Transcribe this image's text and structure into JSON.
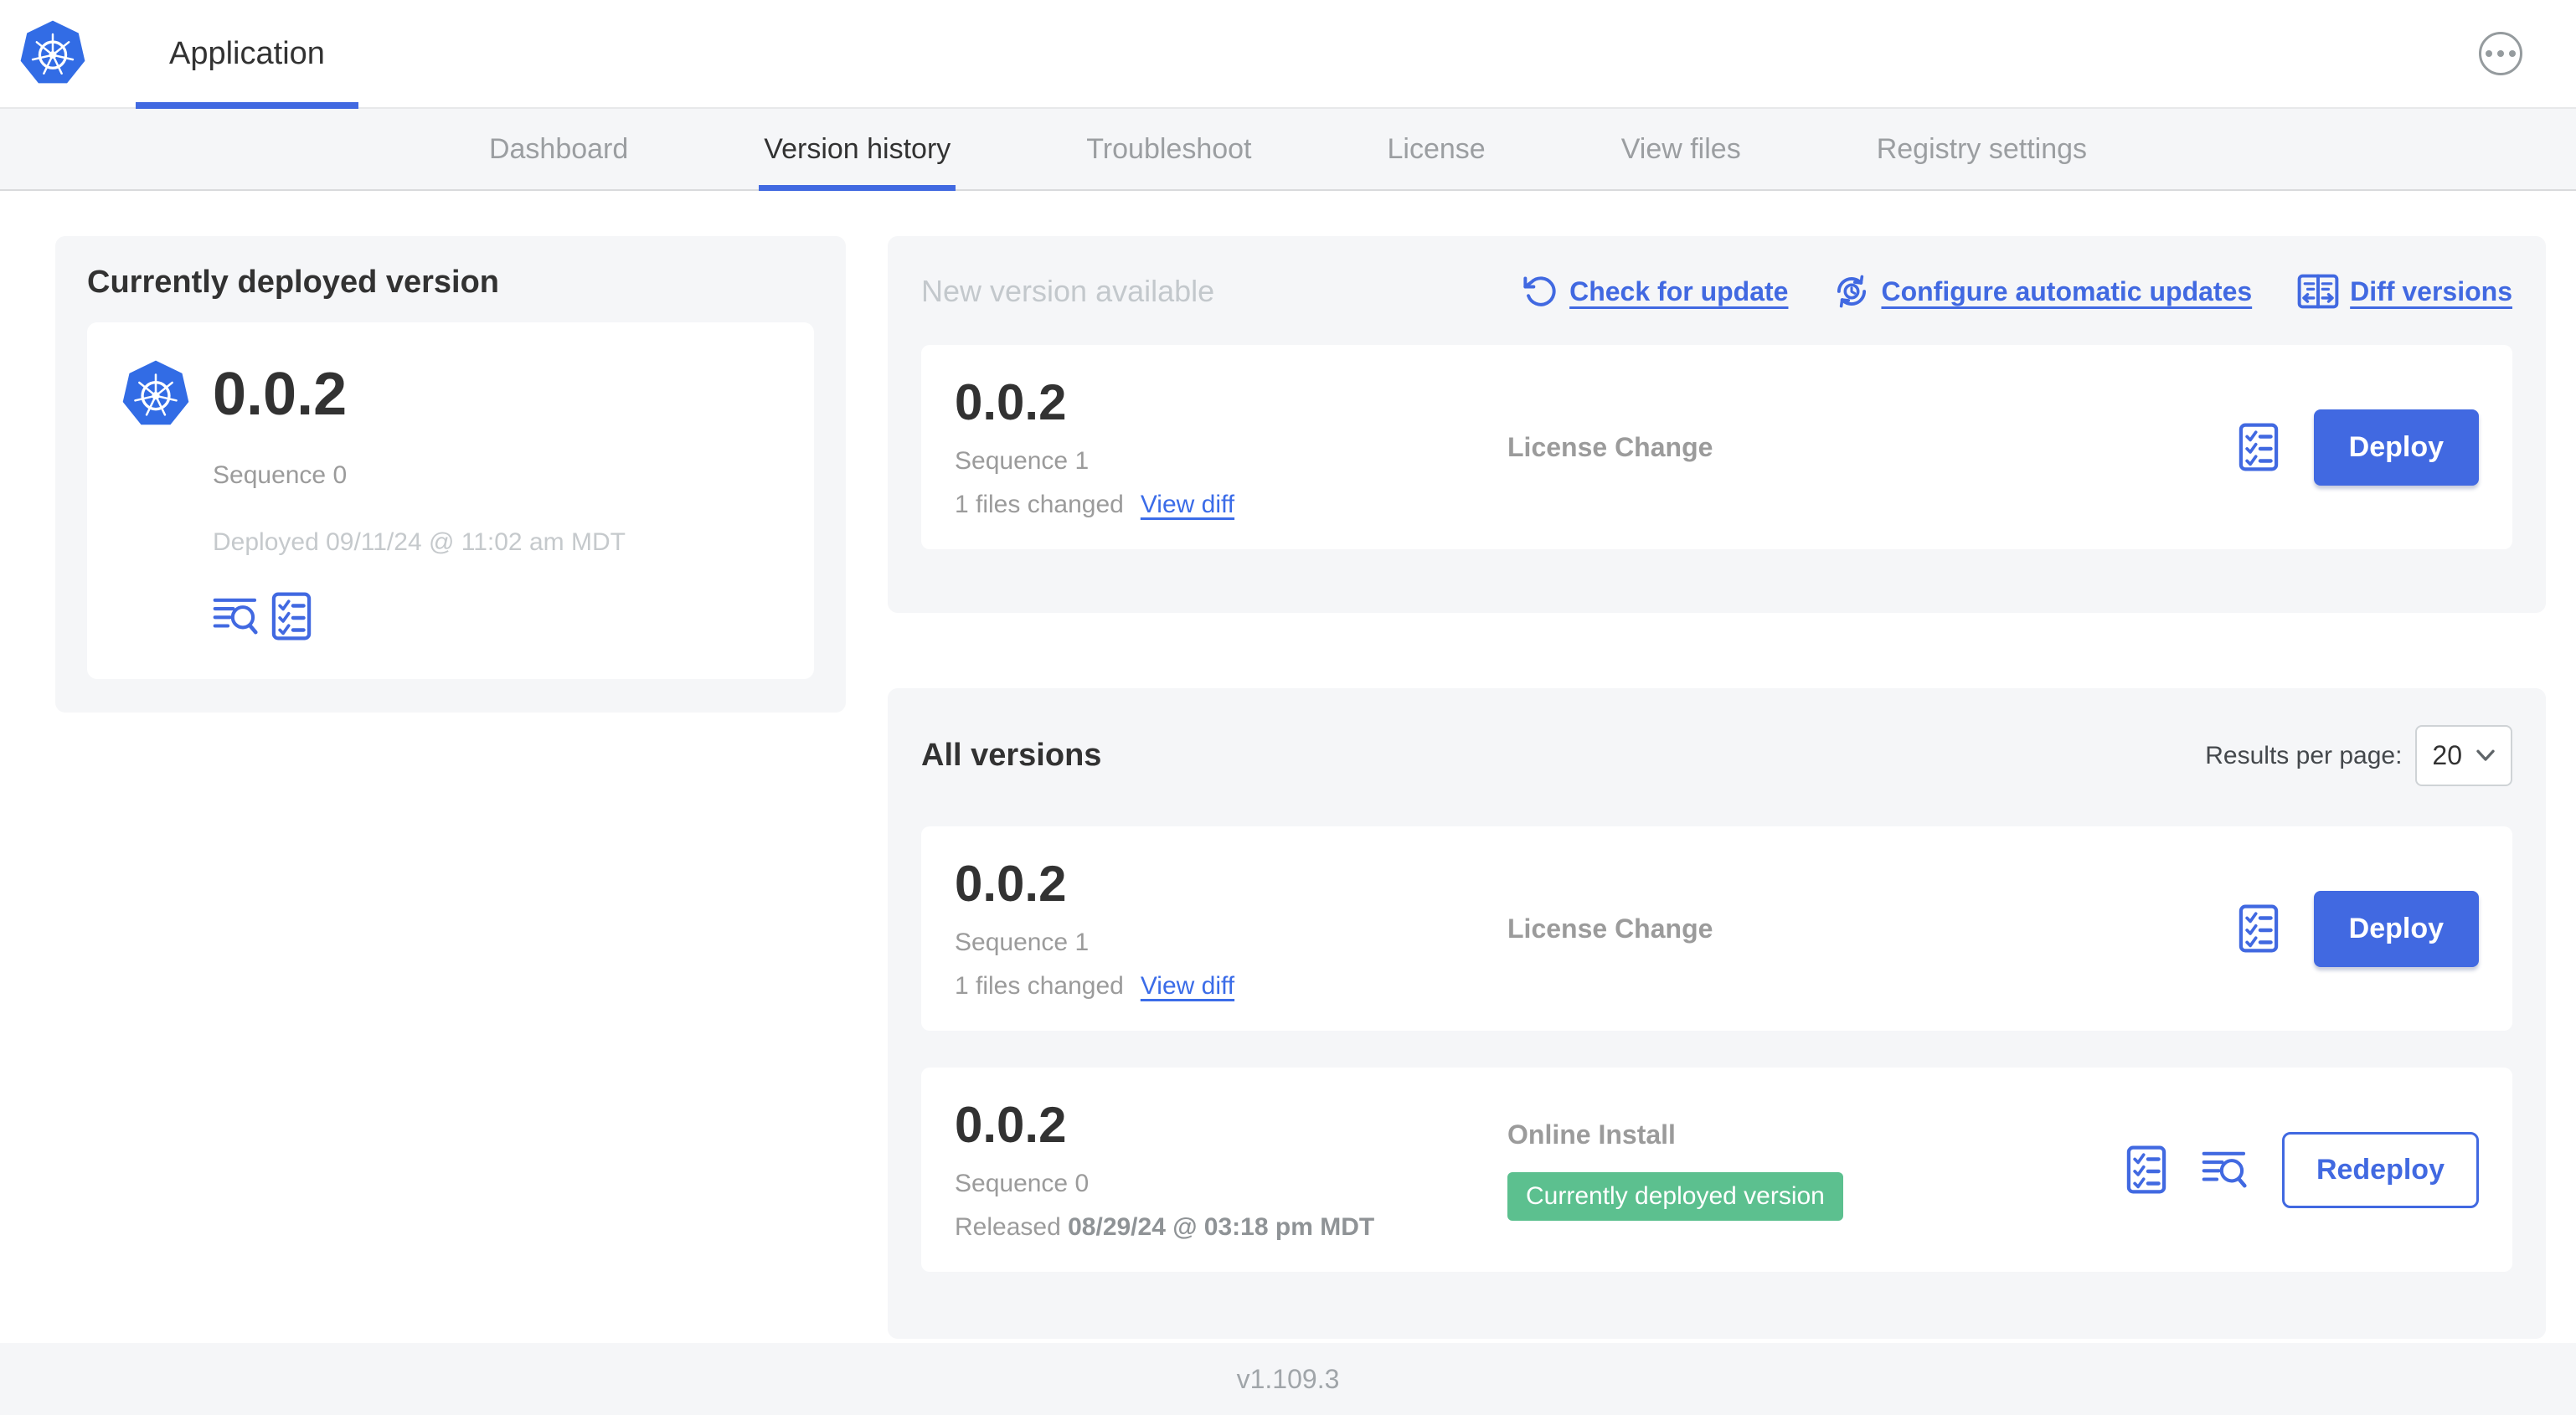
{
  "colors": {
    "accent_blue": "#4169e1",
    "kubernetes_blue": "#326ce5",
    "badge_green": "#5cc08f",
    "text_dark": "#323232",
    "text_gray": "#9b9b9b",
    "text_faint_gray": "#c3c8cc",
    "section_background": "#f5f6f8"
  },
  "header": {
    "app_tab_label": "Application",
    "logo_icon": "kubernetes-logo-icon",
    "more_icon": "ellipsis-icon"
  },
  "subnav": {
    "tabs": [
      {
        "label": "Dashboard",
        "active": false
      },
      {
        "label": "Version history",
        "active": true
      },
      {
        "label": "Troubleshoot",
        "active": false
      },
      {
        "label": "License",
        "active": false
      },
      {
        "label": "View files",
        "active": false
      },
      {
        "label": "Registry settings",
        "active": false
      }
    ]
  },
  "deployed": {
    "title": "Currently deployed version",
    "version": "0.0.2",
    "sequence": "Sequence 0",
    "deployed_at": "Deployed 09/11/24 @ 11:02 am MDT",
    "icons": [
      "logs-icon",
      "checklist-icon"
    ]
  },
  "new_version": {
    "title": "New version available",
    "actions": [
      {
        "label": "Check for update",
        "icon": "refresh-icon"
      },
      {
        "label": "Configure automatic updates",
        "icon": "clock-refresh-icon"
      },
      {
        "label": "Diff versions",
        "icon": "diff-columns-icon"
      }
    ],
    "row": {
      "version": "0.0.2",
      "sequence": "Sequence 1",
      "files_changed": "1 files changed",
      "view_diff": "View diff",
      "source": "License Change",
      "action": "Deploy",
      "icons": [
        "checklist-icon"
      ]
    }
  },
  "all_versions": {
    "title": "All versions",
    "results_per_page_label": "Results per page:",
    "results_per_page_value": "20",
    "select_icon": "chevron-down-icon",
    "rows": [
      {
        "version": "0.0.2",
        "sequence": "Sequence 1",
        "files_changed": "1 files changed",
        "view_diff": "View diff",
        "source": "License Change",
        "action": "Deploy",
        "icons": [
          "checklist-icon"
        ]
      },
      {
        "version": "0.0.2",
        "sequence": "Sequence 0",
        "released_prefix": "Released",
        "released_date": "08/29/24 @ 03:18 pm MDT",
        "source": "Online Install",
        "badge": "Currently deployed version",
        "action": "Redeploy",
        "icons": [
          "checklist-icon",
          "logs-icon"
        ]
      }
    ]
  },
  "footer": {
    "app_version": "v1.109.3"
  }
}
